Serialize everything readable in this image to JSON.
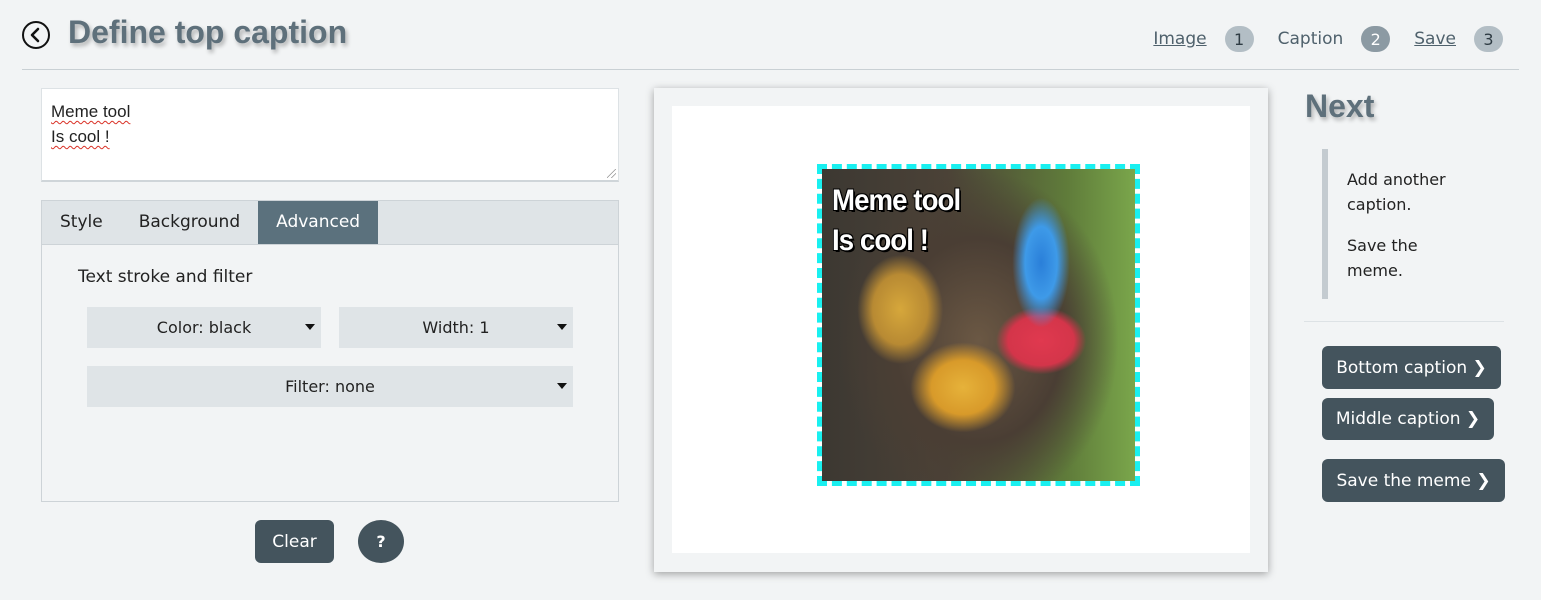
{
  "header": {
    "title": "Define top caption",
    "back_icon": "back-arrow-circle-icon",
    "steps": [
      {
        "label": "Image",
        "number": "1",
        "link": true
      },
      {
        "label": "Caption",
        "number": "2",
        "link": false
      },
      {
        "label": "Save",
        "number": "3",
        "link": true
      }
    ]
  },
  "caption": {
    "lines": [
      "Meme tool",
      "Is cool !"
    ]
  },
  "tabs": [
    {
      "label": "Style",
      "active": false
    },
    {
      "label": "Background",
      "active": false
    },
    {
      "label": "Advanced",
      "active": true
    }
  ],
  "advanced": {
    "section_title": "Text stroke and filter",
    "color_select": "Color: black",
    "width_select": "Width: 1",
    "filter_select": "Filter: none"
  },
  "actions": {
    "clear_label": "Clear",
    "help_label": "?"
  },
  "preview": {
    "meme_lines": [
      "Meme tool",
      "Is cool !"
    ]
  },
  "next": {
    "title": "Next",
    "hints": [
      "Add another caption.",
      "Save the meme."
    ],
    "bottom_caption": "Bottom caption ❯",
    "middle_caption": "Middle caption ❯",
    "save_meme": "Save the meme ❯"
  },
  "colors": {
    "accent": "#5b717d",
    "button": "#44545d",
    "selection_border": "#19f0f0"
  }
}
